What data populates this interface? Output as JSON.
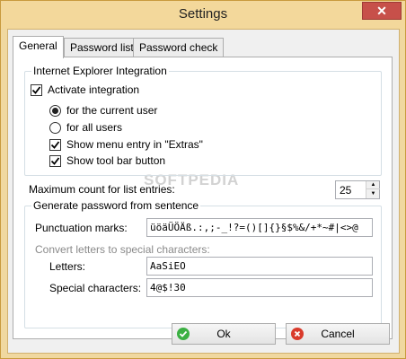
{
  "window": {
    "title": "Settings",
    "close_glyph": "✕"
  },
  "tabs": [
    {
      "label": "General"
    },
    {
      "label": "Password lists"
    },
    {
      "label": "Password check"
    }
  ],
  "ie_group": {
    "legend": "Internet Explorer Integration",
    "activate_label": "Activate integration",
    "activate_checked": true,
    "radio_current_user": "for the current user",
    "radio_all_users": "for all users",
    "radio_selected": "current_user",
    "show_menu_label": "Show menu entry in \"Extras\"",
    "show_menu_checked": true,
    "show_toolbar_label": "Show tool bar button",
    "show_toolbar_checked": true
  },
  "max_count": {
    "label": "Maximum count for list entries:",
    "value": "25"
  },
  "sentence_group": {
    "legend": "Generate password from sentence",
    "punctuation_label": "Punctuation marks:",
    "punctuation_value": "üöäÜÖÄß.:,;-_!?=()[]{}§$%&/+*~#|<>@",
    "convert_label": "Convert letters to special characters:",
    "letters_label": "Letters:",
    "letters_value": "AaSiEO",
    "special_label": "Special characters:",
    "special_value": "4@$!30"
  },
  "watermark": "SOFTPEDIA",
  "buttons": {
    "ok": "Ok",
    "cancel": "Cancel"
  },
  "colors": {
    "ok_icon": "#3cb043",
    "cancel_icon": "#d93a2b",
    "title_bar": "#f3d89b"
  }
}
